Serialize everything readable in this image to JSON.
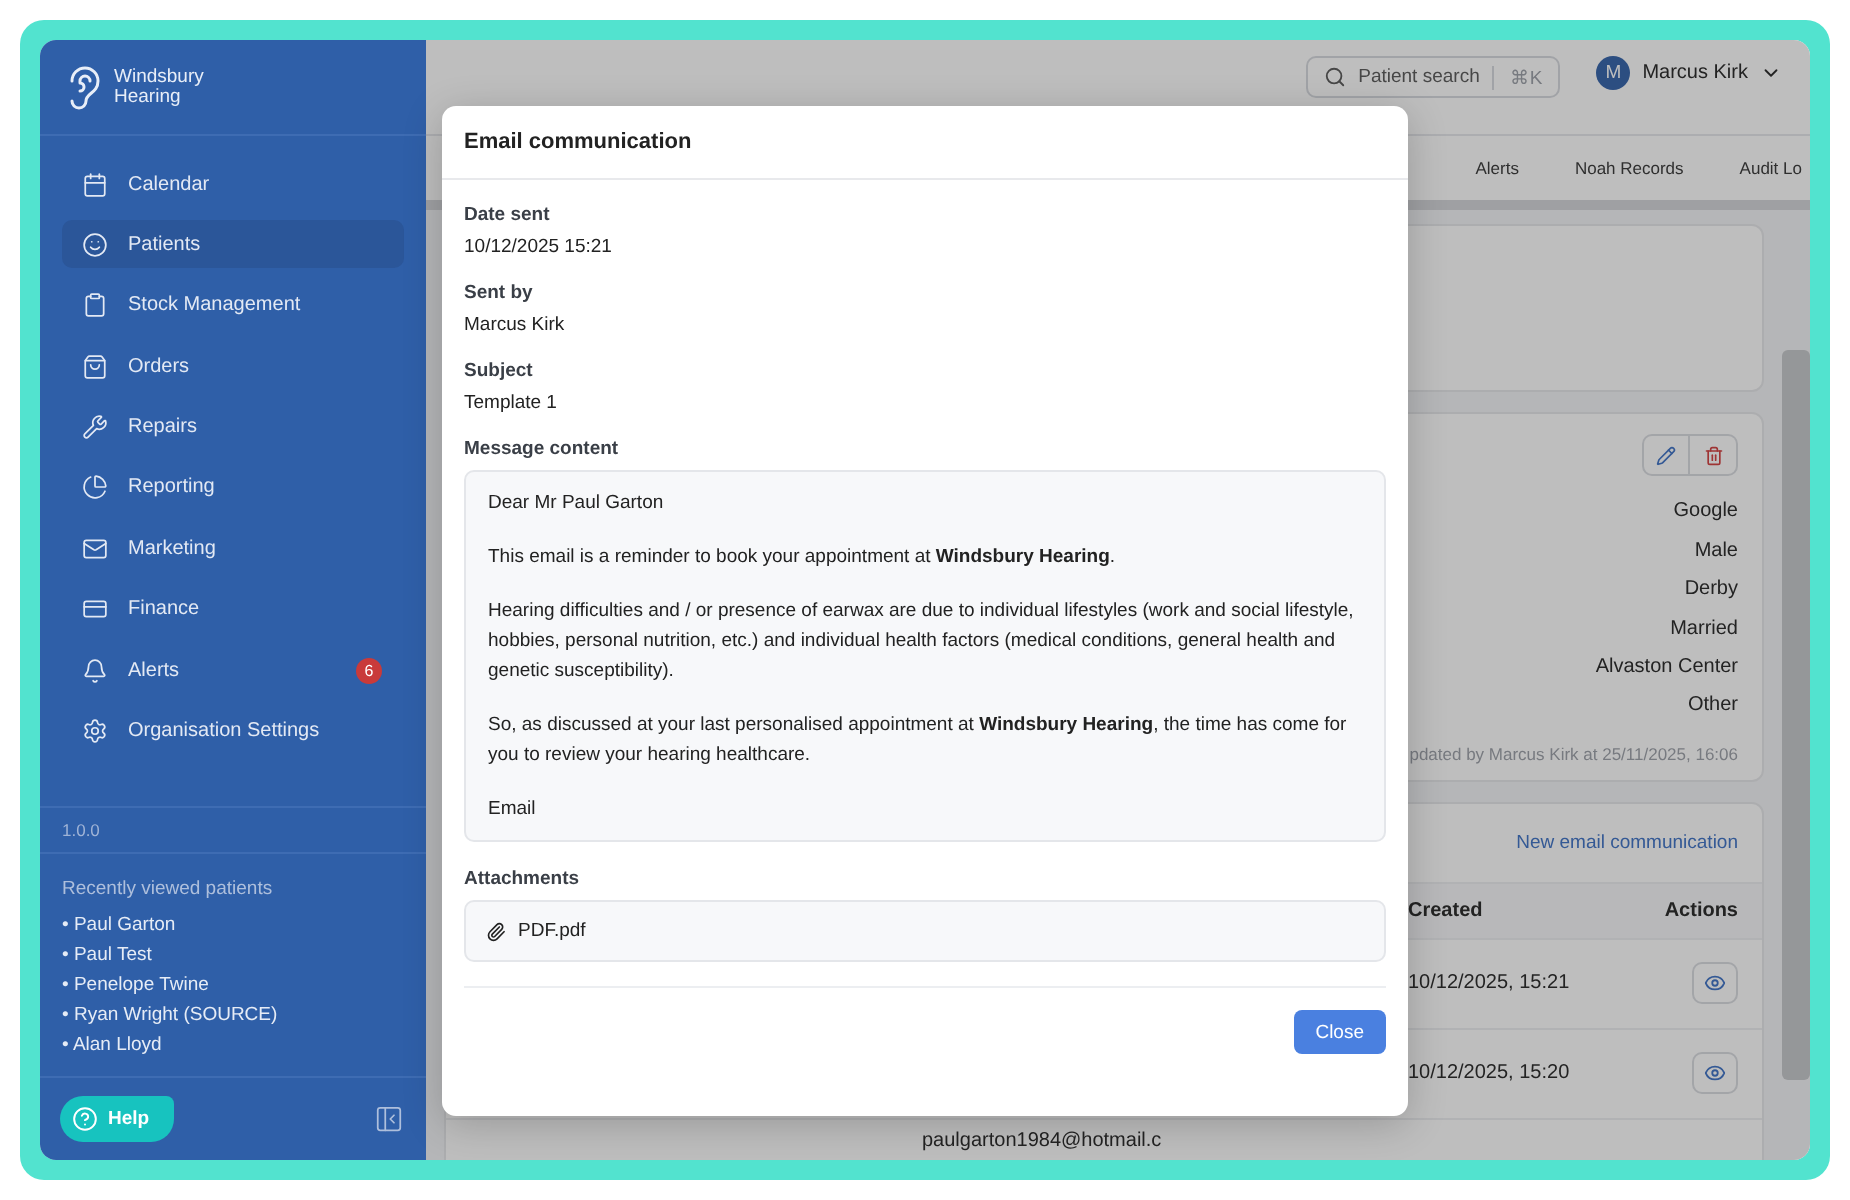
{
  "sidebar": {
    "brand_line_1": "Windsbury",
    "brand_line_2": "Hearing",
    "nav": [
      {
        "label": "Calendar",
        "selected": false
      },
      {
        "label": "Patients",
        "selected": true
      },
      {
        "label": "Stock Management",
        "selected": false
      },
      {
        "label": "Orders",
        "selected": false
      },
      {
        "label": "Repairs",
        "selected": false
      },
      {
        "label": "Reporting",
        "selected": false
      },
      {
        "label": "Marketing",
        "selected": false
      },
      {
        "label": "Finance",
        "selected": false
      },
      {
        "label": "Alerts",
        "selected": false,
        "badge": "6"
      },
      {
        "label": "Organisation Settings",
        "selected": false
      }
    ],
    "version": "1.0.0",
    "recent_title": "Recently viewed patients",
    "recent": [
      "• Paul Garton",
      "• Paul Test",
      "• Penelope Twine",
      "• Ryan Wright (SOURCE)",
      "• Alan Lloyd"
    ],
    "help": "Help"
  },
  "topbar": {
    "search_placeholder": "Patient search",
    "shortcut": "⌘K",
    "user_initial": "M",
    "user_name": "Marcus Kirk"
  },
  "tabs": [
    {
      "label": "Alerts"
    },
    {
      "label": "Noah Records"
    },
    {
      "label": "Audit Lo"
    }
  ],
  "details": {
    "values": [
      "Google",
      "Male",
      "Derby",
      "Married",
      "Alvaston Center",
      "Other"
    ],
    "updated": "pdated by Marcus Kirk at 25/11/2025, 16:06"
  },
  "communications": {
    "new_link": "New email communication",
    "columns": [
      "Created",
      "Actions"
    ],
    "rows": [
      {
        "created": "10/12/2025, 15:21"
      },
      {
        "created": "10/12/2025, 15:20"
      },
      {
        "recipient": "paulgarton1984@hotmail.c"
      }
    ]
  },
  "modal": {
    "title": "Email communication",
    "fields": [
      {
        "label": "Date sent",
        "value": "10/12/2025 15:21"
      },
      {
        "label": "Sent by",
        "value": "Marcus Kirk"
      },
      {
        "label": "Subject",
        "value": "Template 1"
      }
    ],
    "message_label": "Message content",
    "message": [
      "Dear Mr Paul Garton",
      "This email is a reminder to book your appointment at **Windsbury Hearing**.",
      "Hearing difficulties and / or presence of earwax are due to individual lifestyles (work and social lifestyle, hobbies, personal nutrition, etc.) and individual health factors (medical conditions, general health and genetic susceptibility).",
      "So, as discussed at your last personalised appointment at **Windsbury Hearing**, the time has come for you to review your hearing healthcare.",
      "Email"
    ],
    "attachments_label": "Attachments",
    "attachments": [
      "PDF.pdf"
    ],
    "close": "Close"
  }
}
